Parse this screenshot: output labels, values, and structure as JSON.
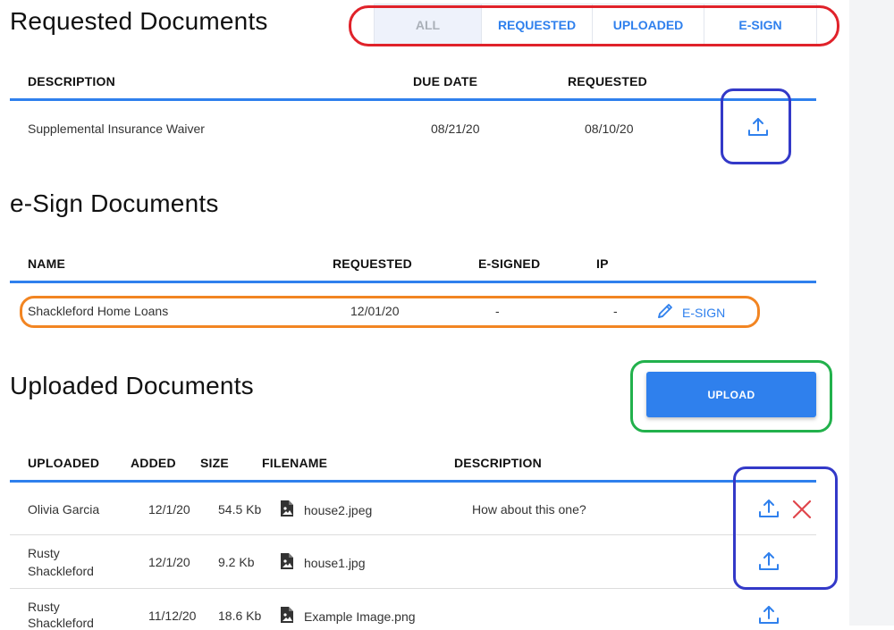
{
  "requested": {
    "title": "Requested Documents",
    "tabs": [
      "ALL",
      "REQUESTED",
      "UPLOADED",
      "E-SIGN"
    ],
    "active_tab": "ALL",
    "columns": {
      "description": "DESCRIPTION",
      "due_date": "DUE DATE",
      "requested": "REQUESTED"
    },
    "rows": [
      {
        "description": "Supplemental Insurance Waiver",
        "due_date": "08/21/20",
        "requested": "08/10/20"
      }
    ]
  },
  "esign": {
    "title": "e-Sign Documents",
    "columns": {
      "name": "NAME",
      "requested": "REQUESTED",
      "esigned": "E-SIGNED",
      "ip": "IP"
    },
    "rows": [
      {
        "name": "Shackleford Home Loans",
        "requested": "12/01/20",
        "esigned": "-",
        "ip": "-",
        "action_label": "E-SIGN"
      }
    ]
  },
  "uploaded": {
    "title": "Uploaded Documents",
    "upload_button": "UPLOAD",
    "columns": {
      "uploaded": "UPLOADED",
      "added": "ADDED",
      "size": "SIZE",
      "filename": "FILENAME",
      "description": "DESCRIPTION"
    },
    "rows": [
      {
        "uploaded_line1": "Olivia Garcia",
        "uploaded_line2": "",
        "added": "12/1/20",
        "size": "54.5 Kb",
        "filename": "house2.jpeg",
        "description": "How about this one?"
      },
      {
        "uploaded_line1": "Rusty",
        "uploaded_line2": "Shackleford",
        "added": "12/1/20",
        "size": "9.2 Kb",
        "filename": "house1.jpg",
        "description": ""
      },
      {
        "uploaded_line1": "Rusty",
        "uploaded_line2": "Shackleford",
        "added": "11/12/20",
        "size": "18.6 Kb",
        "filename": "Example Image.png",
        "description": ""
      }
    ]
  },
  "colors": {
    "accent": "#2f80ed",
    "delete": "#e0464c",
    "annotation_red": "#e0222a",
    "annotation_blue": "#3339c8",
    "annotation_orange": "#f28522",
    "annotation_green": "#22b14c"
  },
  "icons": {
    "upload": "upload-arrow-icon",
    "delete": "close-x-icon",
    "edit": "pencil-icon",
    "file": "image-file-icon"
  }
}
